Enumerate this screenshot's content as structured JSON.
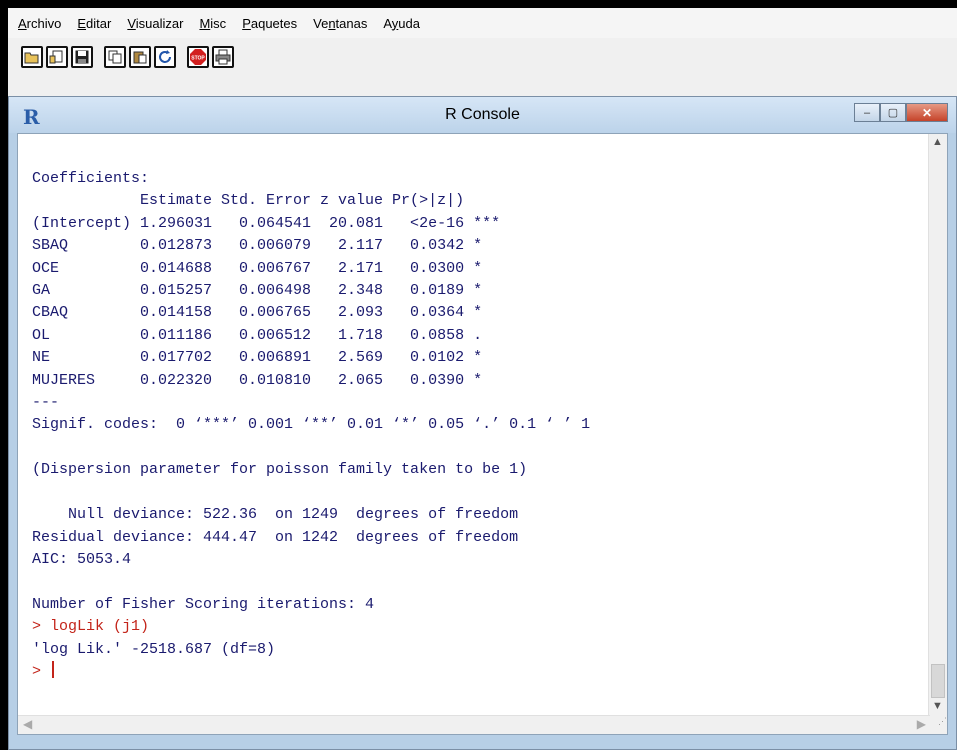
{
  "menubar": {
    "items": [
      {
        "pre": "",
        "key": "A",
        "post": "rchivo"
      },
      {
        "pre": "",
        "key": "E",
        "post": "ditar"
      },
      {
        "pre": "",
        "key": "V",
        "post": "isualizar"
      },
      {
        "pre": "",
        "key": "M",
        "post": "isc"
      },
      {
        "pre": "",
        "key": "P",
        "post": "aquetes"
      },
      {
        "pre": "Ve",
        "key": "n",
        "post": "tanas"
      },
      {
        "pre": "A",
        "key": "y",
        "post": "uda"
      }
    ]
  },
  "toolbar": {
    "icons": [
      "open-script-icon",
      "load-workspace-icon",
      "save-icon",
      "copy-icon",
      "paste-icon",
      "refresh-icon",
      "stop-icon",
      "print-icon"
    ],
    "stop_label": "STOP"
  },
  "window": {
    "title": "R Console",
    "logo": "R",
    "minimize_label": "–",
    "maximize_label": "▢",
    "close_label": "✕"
  },
  "console": {
    "output": "Coefficients:\n            Estimate Std. Error z value Pr(>|z|)    \n(Intercept) 1.296031   0.064541  20.081   <2e-16 ***\nSBAQ        0.012873   0.006079   2.117   0.0342 *  \nOCE         0.014688   0.006767   2.171   0.0300 *  \nGA          0.015257   0.006498   2.348   0.0189 *  \nCBAQ        0.014158   0.006765   2.093   0.0364 *  \nOL          0.011186   0.006512   1.718   0.0858 .  \nNE          0.017702   0.006891   2.569   0.0102 *  \nMUJERES     0.022320   0.010810   2.065   0.0390 *  \n---\nSignif. codes:  0 ‘***’ 0.001 ‘**’ 0.01 ‘*’ 0.05 ‘.’ 0.1 ‘ ’ 1\n\n(Dispersion parameter for poisson family taken to be 1)\n\n    Null deviance: 522.36  on 1249  degrees of freedom\nResidual deviance: 444.47  on 1242  degrees of freedom\nAIC: 5053.4\n\nNumber of Fisher Scoring iterations: 4\n",
    "command": "> logLik (j1)",
    "result": "'log Lik.' -2518.687 (df=8)",
    "prompt": "> "
  }
}
